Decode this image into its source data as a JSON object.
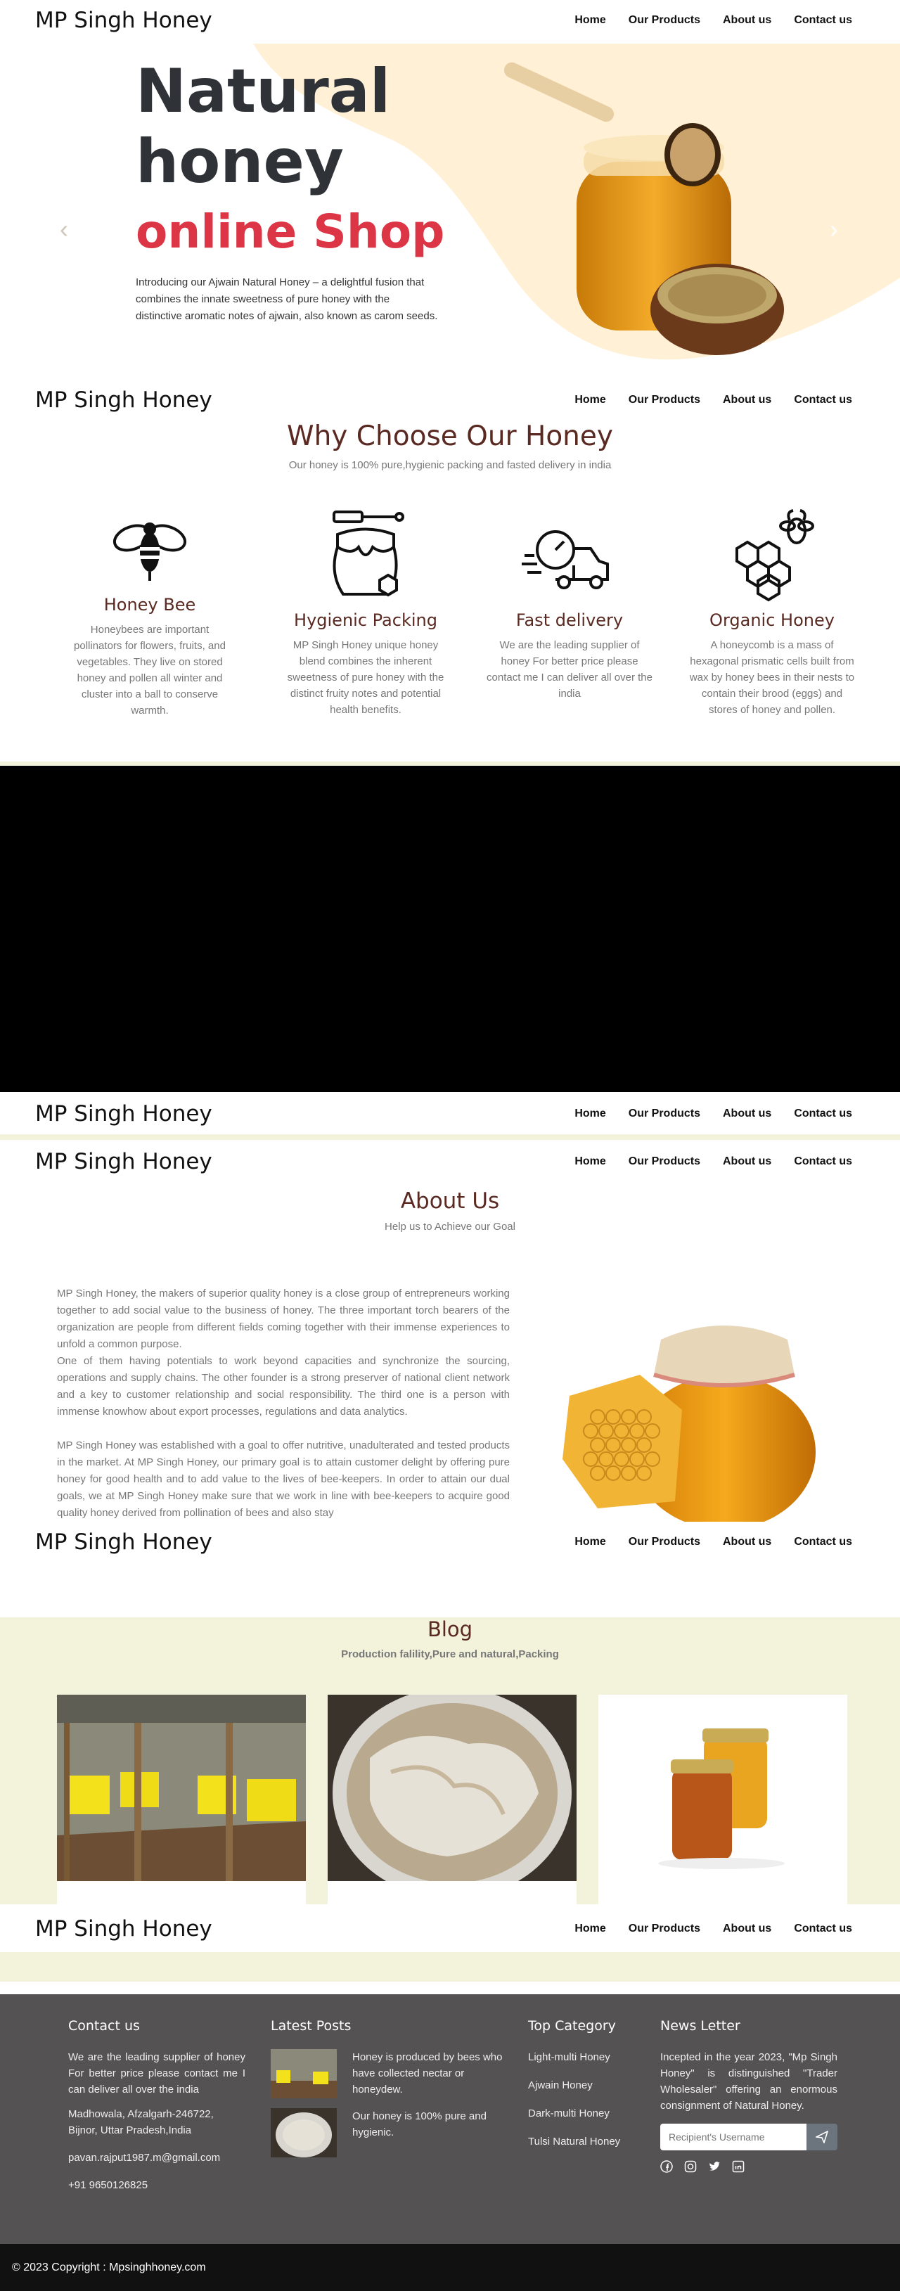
{
  "brand": "MP Singh Honey",
  "nav": [
    "Home",
    "Our Products",
    "About us",
    "Contact us"
  ],
  "hero": {
    "line1": "Natural",
    "line2": "honey",
    "line3": "online Shop",
    "desc": "Introducing our Ajwain Natural Honey – a delightful fusion that combines the innate sweetness of pure honey with the distinctive aromatic notes of ajwain, also known as carom seeds.",
    "prev": "‹",
    "next": "›"
  },
  "why": {
    "title": "Why Choose Our Honey",
    "subtitle": "Our honey is 100% pure,hygienic packing and fasted delivery in india",
    "features": [
      {
        "icon": "bee-icon",
        "title": "Honey Bee",
        "text": "Honeybees are important pollinators for flowers, fruits, and vegetables. They live on stored honey and pollen all winter and cluster into a ball to conserve warmth."
      },
      {
        "icon": "honey-jar-icon",
        "title": "Hygienic Packing",
        "text": "MP Singh Honey unique honey blend combines the inherent sweetness of pure honey with the distinct fruity notes and potential health benefits."
      },
      {
        "icon": "delivery-truck-icon",
        "title": "Fast delivery",
        "text": "We are the leading supplier of honey For better price please contact me I can deliver all over the india"
      },
      {
        "icon": "honeycomb-icon",
        "title": "Organic Honey",
        "text": "A honeycomb is a mass of hexagonal prismatic cells built from wax by honey bees in their nests to contain their brood (eggs) and stores of honey and pollen."
      }
    ]
  },
  "about": {
    "title": "About Us",
    "subtitle": "Help us to Achieve our Goal",
    "p1": "MP Singh Honey, the makers of superior quality honey is a close group of entrepreneurs working together to add social value to the business of honey. The three important torch bearers of the organization are people from different fields coming together with their immense experiences to unfold a common purpose.",
    "p2": "One of them having potentials to work beyond capacities and synchronize the sourcing, operations and supply chains. The other founder is a strong preserver of national client network and a key to customer relationship and social responsibility. The third one is a person with immense knowhow about export processes, regulations and data analytics.",
    "p3": "MP Singh Honey was established with a goal to offer nutritive, unadulterated and tested products in the market. At MP Singh Honey, our primary goal is to attain customer delight by offering pure honey for good health and to add value to the lives of bee-keepers. In order to attain our dual goals, we at MP Singh Honey make sure that we work in line with bee-keepers to acquire good quality honey derived from pollination of bees and also stay"
  },
  "blog": {
    "title": "Blog",
    "subtitle": "Production falility,Pure and natural,Packing"
  },
  "footer": {
    "contact_title": "Contact us",
    "contact_text": "We are the leading supplier of honey For better price please contact me I can deliver all over the india",
    "address": "Madhowala, Afzalgarh-246722, Bijnor, Uttar Pradesh,India",
    "email": "pavan.rajput1987.m@gmail.com",
    "phone": "+91 9650126825",
    "posts_title": "Latest Posts",
    "post1": "Honey is produced by bees who have collected nectar or honeydew.",
    "post2": "Our honey is 100% pure and hygienic.",
    "category_title": "Top Category",
    "categories": [
      "Light-multi Honey",
      "Ajwain Honey",
      "Dark-multi Honey",
      "Tulsi Natural Honey"
    ],
    "news_title": "News Letter",
    "news_text": "Incepted in the year 2023, \"Mp Singh Honey\" is distinguished \"Trader Wholesaler\" offering an enormous consignment of Natural Honey.",
    "news_placeholder": "Recipient's Username"
  },
  "copyright": "© 2023 Copyright : Mpsinghhoney.com",
  "colors": {
    "accent": "#dc3545",
    "title": "#5a2a22",
    "cream": "#fff0d6",
    "strip": "#f3f3db",
    "footer": "#545252"
  }
}
